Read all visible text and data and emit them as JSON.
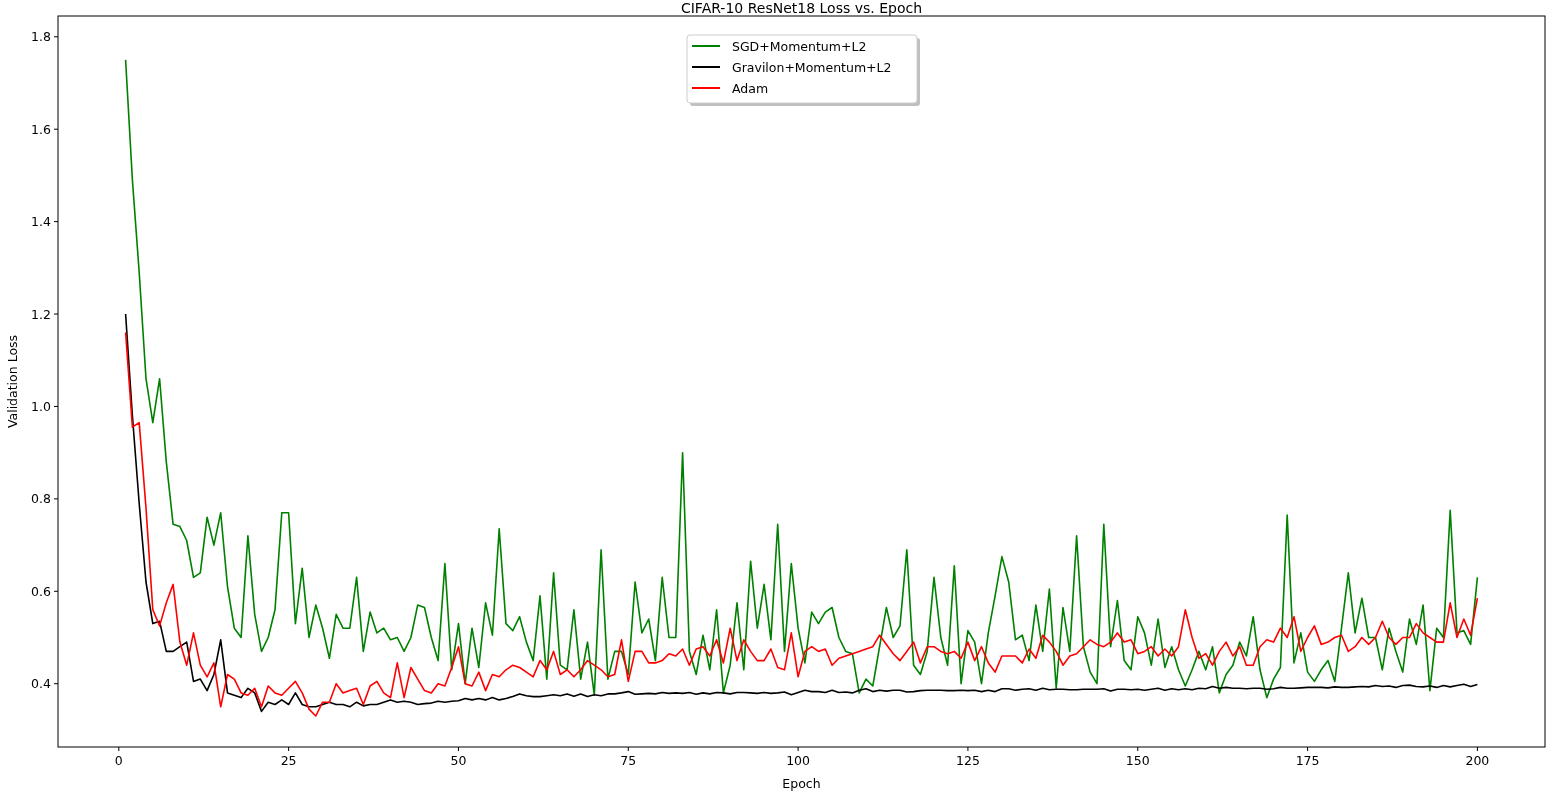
{
  "figure": {
    "chart_data": {
      "type": "line",
      "title": "CIFAR-10 ResNet18 Loss vs. Epoch",
      "xlabel": "Epoch",
      "ylabel": "Validation Loss",
      "legend": true,
      "x": [
        1,
        2,
        3,
        4,
        5,
        6,
        7,
        8,
        9,
        10,
        11,
        12,
        13,
        14,
        15,
        16,
        17,
        18,
        19,
        20,
        21,
        22,
        23,
        24,
        25,
        26,
        27,
        28,
        29,
        30,
        31,
        32,
        33,
        34,
        35,
        36,
        37,
        38,
        39,
        40,
        41,
        42,
        43,
        44,
        45,
        46,
        47,
        48,
        49,
        50,
        51,
        52,
        53,
        54,
        55,
        56,
        57,
        58,
        59,
        60,
        61,
        62,
        63,
        64,
        65,
        66,
        67,
        68,
        69,
        70,
        71,
        72,
        73,
        74,
        75,
        76,
        77,
        78,
        79,
        80,
        81,
        82,
        83,
        84,
        85,
        86,
        87,
        88,
        89,
        90,
        91,
        92,
        93,
        94,
        95,
        96,
        97,
        98,
        99,
        100,
        101,
        102,
        103,
        104,
        105,
        106,
        107,
        108,
        109,
        110,
        111,
        112,
        113,
        114,
        115,
        116,
        117,
        118,
        119,
        120,
        121,
        122,
        123,
        124,
        125,
        126,
        127,
        128,
        129,
        130,
        131,
        132,
        133,
        134,
        135,
        136,
        137,
        138,
        139,
        140,
        141,
        142,
        143,
        144,
        145,
        146,
        147,
        148,
        149,
        150,
        151,
        152,
        153,
        154,
        155,
        156,
        157,
        158,
        159,
        160,
        161,
        162,
        163,
        164,
        165,
        166,
        167,
        168,
        169,
        170,
        171,
        172,
        173,
        174,
        175,
        176,
        177,
        178,
        179,
        180,
        181,
        182,
        183,
        184,
        185,
        186,
        187,
        188,
        189,
        190,
        191,
        192,
        193,
        194,
        195,
        196,
        197,
        198,
        199,
        200
      ],
      "xlim": [
        -8.95,
        209.95
      ],
      "ylim": [
        0.263,
        1.845
      ],
      "xticks": [
        0,
        25,
        50,
        75,
        100,
        125,
        150,
        175,
        200
      ],
      "yticks": [
        {
          "value": 0.4,
          "label": "0.4"
        },
        {
          "value": 0.6,
          "label": "0.6"
        },
        {
          "value": 0.8,
          "label": "0.8"
        },
        {
          "value": 1.0,
          "label": "1.0"
        },
        {
          "value": 1.2,
          "label": "1.2"
        },
        {
          "value": 1.4,
          "label": "1.4"
        },
        {
          "value": 1.6,
          "label": "1.6"
        },
        {
          "value": 1.8,
          "label": "1.8"
        }
      ],
      "series": [
        {
          "name": "SGD+Momentum+L2",
          "color": "#008000",
          "values": [
            1.75,
            1.49,
            1.29,
            1.06,
            0.965,
            1.06,
            0.88,
            0.745,
            0.74,
            0.71,
            0.63,
            0.64,
            0.76,
            0.7,
            0.77,
            0.61,
            0.52,
            0.5,
            0.72,
            0.55,
            0.47,
            0.5,
            0.56,
            0.77,
            0.77,
            0.53,
            0.65,
            0.5,
            0.57,
            0.52,
            0.455,
            0.55,
            0.52,
            0.52,
            0.63,
            0.47,
            0.555,
            0.51,
            0.52,
            0.495,
            0.5,
            0.47,
            0.5,
            0.57,
            0.565,
            0.5,
            0.45,
            0.66,
            0.43,
            0.53,
            0.4,
            0.52,
            0.435,
            0.575,
            0.505,
            0.735,
            0.53,
            0.515,
            0.545,
            0.49,
            0.45,
            0.59,
            0.41,
            0.64,
            0.44,
            0.43,
            0.56,
            0.41,
            0.49,
            0.375,
            0.69,
            0.41,
            0.47,
            0.47,
            0.42,
            0.62,
            0.51,
            0.54,
            0.45,
            0.63,
            0.5,
            0.5,
            0.9,
            0.47,
            0.42,
            0.505,
            0.43,
            0.56,
            0.38,
            0.44,
            0.575,
            0.43,
            0.665,
            0.52,
            0.615,
            0.495,
            0.745,
            0.47,
            0.66,
            0.52,
            0.445,
            0.555,
            0.53,
            0.555,
            0.565,
            0.5,
            0.47,
            0.465,
            0.38,
            0.41,
            0.395,
            0.48,
            0.565,
            0.5,
            0.525,
            0.69,
            0.44,
            0.42,
            0.47,
            0.63,
            0.5,
            0.44,
            0.655,
            0.4,
            0.515,
            0.49,
            0.4,
            0.51,
            0.59,
            0.675,
            0.62,
            0.495,
            0.505,
            0.45,
            0.57,
            0.47,
            0.605,
            0.39,
            0.565,
            0.47,
            0.72,
            0.48,
            0.425,
            0.4,
            0.745,
            0.48,
            0.58,
            0.45,
            0.43,
            0.545,
            0.51,
            0.44,
            0.54,
            0.435,
            0.48,
            0.43,
            0.395,
            0.43,
            0.47,
            0.43,
            0.48,
            0.38,
            0.42,
            0.44,
            0.49,
            0.46,
            0.545,
            0.43,
            0.37,
            0.41,
            0.435,
            0.765,
            0.445,
            0.51,
            0.425,
            0.405,
            0.43,
            0.45,
            0.405,
            0.52,
            0.64,
            0.51,
            0.585,
            0.5,
            0.5,
            0.43,
            0.52,
            0.47,
            0.425,
            0.54,
            0.485,
            0.57,
            0.385,
            0.52,
            0.5,
            0.775,
            0.51,
            0.515,
            0.485,
            0.63
          ]
        },
        {
          "name": "Gravilon+Momentum+L2",
          "color": "#000000",
          "values": [
            1.2,
            0.98,
            0.79,
            0.62,
            0.53,
            0.535,
            0.47,
            0.47,
            0.48,
            0.49,
            0.405,
            0.41,
            0.385,
            0.42,
            0.495,
            0.38,
            0.375,
            0.37,
            0.39,
            0.38,
            0.34,
            0.36,
            0.355,
            0.365,
            0.355,
            0.38,
            0.355,
            0.35,
            0.35,
            0.355,
            0.36,
            0.355,
            0.355,
            0.35,
            0.36,
            0.352,
            0.355,
            0.355,
            0.36,
            0.365,
            0.36,
            0.362,
            0.36,
            0.355,
            0.357,
            0.358,
            0.362,
            0.36,
            0.362,
            0.363,
            0.368,
            0.365,
            0.368,
            0.365,
            0.37,
            0.365,
            0.368,
            0.372,
            0.378,
            0.374,
            0.372,
            0.372,
            0.374,
            0.376,
            0.374,
            0.378,
            0.373,
            0.378,
            0.372,
            0.376,
            0.374,
            0.378,
            0.378,
            0.38,
            0.383,
            0.377,
            0.378,
            0.379,
            0.378,
            0.381,
            0.379,
            0.38,
            0.379,
            0.381,
            0.377,
            0.38,
            0.378,
            0.381,
            0.38,
            0.378,
            0.381,
            0.381,
            0.38,
            0.379,
            0.381,
            0.379,
            0.38,
            0.382,
            0.376,
            0.381,
            0.386,
            0.383,
            0.383,
            0.381,
            0.386,
            0.381,
            0.382,
            0.38,
            0.386,
            0.389,
            0.383,
            0.386,
            0.384,
            0.386,
            0.386,
            0.382,
            0.383,
            0.385,
            0.386,
            0.386,
            0.386,
            0.385,
            0.385,
            0.386,
            0.385,
            0.386,
            0.383,
            0.386,
            0.383,
            0.389,
            0.389,
            0.386,
            0.388,
            0.389,
            0.386,
            0.39,
            0.387,
            0.388,
            0.388,
            0.387,
            0.387,
            0.388,
            0.388,
            0.388,
            0.389,
            0.384,
            0.388,
            0.388,
            0.387,
            0.388,
            0.386,
            0.388,
            0.39,
            0.386,
            0.389,
            0.387,
            0.389,
            0.387,
            0.39,
            0.389,
            0.394,
            0.39,
            0.392,
            0.39,
            0.39,
            0.389,
            0.39,
            0.39,
            0.388,
            0.389,
            0.392,
            0.39,
            0.39,
            0.391,
            0.392,
            0.392,
            0.392,
            0.391,
            0.393,
            0.392,
            0.392,
            0.393,
            0.394,
            0.393,
            0.396,
            0.394,
            0.395,
            0.392,
            0.396,
            0.397,
            0.394,
            0.393,
            0.395,
            0.392,
            0.396,
            0.393,
            0.396,
            0.399,
            0.394,
            0.398
          ]
        },
        {
          "name": "Adam",
          "color": "#ff0000",
          "values": [
            1.16,
            0.955,
            0.965,
            0.78,
            0.56,
            0.525,
            0.575,
            0.615,
            0.49,
            0.44,
            0.51,
            0.44,
            0.415,
            0.445,
            0.35,
            0.42,
            0.41,
            0.38,
            0.375,
            0.39,
            0.35,
            0.395,
            0.38,
            0.375,
            0.39,
            0.405,
            0.38,
            0.345,
            0.33,
            0.36,
            0.36,
            0.4,
            0.38,
            0.385,
            0.39,
            0.355,
            0.395,
            0.405,
            0.38,
            0.37,
            0.445,
            0.37,
            0.435,
            0.41,
            0.385,
            0.38,
            0.4,
            0.395,
            0.435,
            0.48,
            0.4,
            0.395,
            0.425,
            0.385,
            0.42,
            0.415,
            0.43,
            0.44,
            0.435,
            0.425,
            0.415,
            0.45,
            0.43,
            0.47,
            0.42,
            0.43,
            0.415,
            0.43,
            0.45,
            0.44,
            0.43,
            0.415,
            0.42,
            0.495,
            0.405,
            0.47,
            0.47,
            0.445,
            0.445,
            0.45,
            0.465,
            0.46,
            0.475,
            0.44,
            0.475,
            0.48,
            0.46,
            0.495,
            0.445,
            0.52,
            0.45,
            0.495,
            0.47,
            0.45,
            0.45,
            0.475,
            0.435,
            0.43,
            0.51,
            0.415,
            0.47,
            0.48,
            0.47,
            0.475,
            0.44,
            0.455,
            0.46,
            0.465,
            0.47,
            0.475,
            0.48,
            0.505,
            0.485,
            0.465,
            0.45,
            0.47,
            0.49,
            0.445,
            0.48,
            0.48,
            0.47,
            0.465,
            0.47,
            0.455,
            0.49,
            0.45,
            0.48,
            0.445,
            0.425,
            0.46,
            0.46,
            0.46,
            0.445,
            0.475,
            0.455,
            0.505,
            0.49,
            0.47,
            0.44,
            0.46,
            0.465,
            0.48,
            0.495,
            0.485,
            0.48,
            0.49,
            0.51,
            0.49,
            0.495,
            0.465,
            0.47,
            0.48,
            0.46,
            0.475,
            0.46,
            0.48,
            0.56,
            0.5,
            0.455,
            0.465,
            0.44,
            0.47,
            0.49,
            0.46,
            0.48,
            0.44,
            0.44,
            0.48,
            0.495,
            0.49,
            0.52,
            0.5,
            0.545,
            0.47,
            0.5,
            0.525,
            0.485,
            0.49,
            0.5,
            0.505,
            0.47,
            0.48,
            0.5,
            0.485,
            0.5,
            0.535,
            0.5,
            0.485,
            0.5,
            0.5,
            0.53,
            0.51,
            0.5,
            0.49,
            0.49,
            0.575,
            0.5,
            0.54,
            0.505,
            0.585
          ]
        }
      ]
    }
  }
}
